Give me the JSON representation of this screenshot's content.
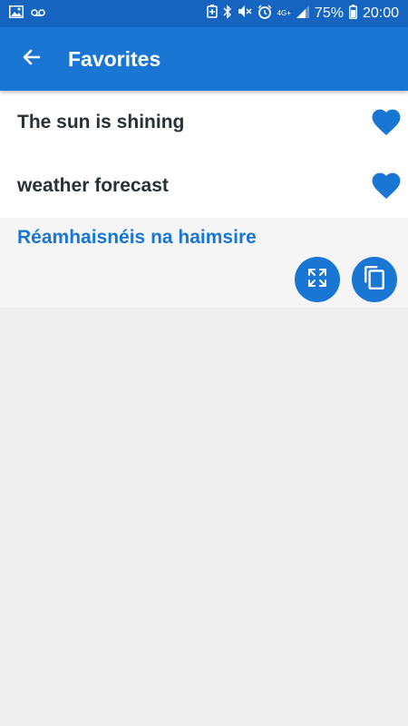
{
  "status_bar": {
    "network": "4G+",
    "battery": "75%",
    "time": "20:00",
    "icons": [
      "image-icon",
      "voicemail-icon",
      "battery-saver-icon",
      "bluetooth-icon",
      "mute-icon",
      "alarm-icon",
      "signal-icon",
      "battery-icon"
    ]
  },
  "app_bar": {
    "title": "Favorites",
    "back_icon": "arrow-back-icon"
  },
  "favorites": [
    {
      "text": "The sun is shining",
      "favorite_icon": "heart-icon"
    },
    {
      "text": "weather forecast",
      "favorite_icon": "heart-icon"
    }
  ],
  "expanded_item": {
    "translation": "Réamhaisnéis na haimsire",
    "actions": [
      "fullscreen-icon",
      "copy-icon"
    ]
  },
  "colors": {
    "status_bar": "#1565c0",
    "app_bar": "#1976d2",
    "accent": "#1976d2",
    "text_dark": "#263238",
    "background": "#eeeeee"
  }
}
